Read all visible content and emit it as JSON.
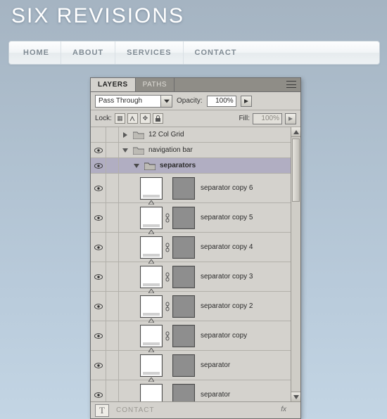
{
  "site": {
    "title": "SIX REVISIONS"
  },
  "nav": {
    "items": [
      {
        "label": "HOME"
      },
      {
        "label": "ABOUT"
      },
      {
        "label": "SERVICES"
      },
      {
        "label": "CONTACT"
      }
    ]
  },
  "panel": {
    "tabs": {
      "layers": "LAYERS",
      "paths": "PATHS"
    },
    "blend_mode": "Pass Through",
    "opacity_label": "Opacity:",
    "opacity_value": "100%",
    "lock_label": "Lock:",
    "fill_label": "Fill:",
    "fill_value": "100%",
    "groups": {
      "grid": {
        "name": "12 Col Grid"
      },
      "navbar": {
        "name": "navigation bar"
      },
      "separators": {
        "name": "separators"
      }
    },
    "separators": [
      {
        "name": "separator copy 6",
        "linked": false
      },
      {
        "name": "separator copy 5",
        "linked": true
      },
      {
        "name": "separator copy 4",
        "linked": true
      },
      {
        "name": "separator copy 3",
        "linked": true
      },
      {
        "name": "separator copy 2",
        "linked": true
      },
      {
        "name": "separator copy",
        "linked": true
      },
      {
        "name": "separator",
        "linked": false
      },
      {
        "name": "separator",
        "linked": false
      }
    ],
    "footer": {
      "text_layer": "CONTACT",
      "fx": "fx"
    }
  }
}
